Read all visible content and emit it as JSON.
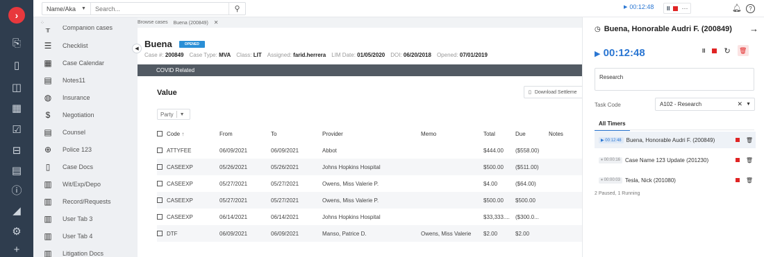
{
  "app": {
    "logo_glyph": "›",
    "accent": "#2a76d2",
    "danger": "#e02424",
    "rail_color": "#2f3d4e"
  },
  "rail": {
    "icons": [
      "briefcase-icon",
      "document-icon",
      "contact-card-icon",
      "calendar-icon",
      "checkbox-icon",
      "inbox-icon",
      "messages-icon",
      "info-icon",
      "chart-icon",
      "settings-icon",
      "plus-icon"
    ],
    "glyphs": [
      "⎘",
      "▯",
      "◫",
      "▦",
      "☑",
      "⊟",
      "▤",
      "ⓘ",
      "◢",
      "⚙",
      "+"
    ]
  },
  "topbar": {
    "search_scope": "Name/Aka",
    "search_placeholder": "Search...",
    "timer_display": "00:12:48",
    "more_glyph": "···"
  },
  "tabs": [
    "Browse cases",
    "Buena (200849)"
  ],
  "sidebar": {
    "partial_label": "Companion cases",
    "items": [
      {
        "label": "Checklist",
        "icon": "checklist-icon",
        "glyph": "☰"
      },
      {
        "label": "Case Calendar",
        "icon": "calendar-icon",
        "glyph": "▦"
      },
      {
        "label": "Notes11",
        "icon": "notes-icon",
        "glyph": "▤"
      },
      {
        "label": "Insurance",
        "icon": "shield-icon",
        "glyph": "◍"
      },
      {
        "label": "Negotiation",
        "icon": "dollar-icon",
        "glyph": "$"
      },
      {
        "label": "Counsel",
        "icon": "counsel-icon",
        "glyph": "▤"
      },
      {
        "label": "Police 123",
        "icon": "police-icon",
        "glyph": "⊕"
      },
      {
        "label": "Case Docs",
        "icon": "docs-icon",
        "glyph": "▯"
      },
      {
        "label": "Wit/Exp/Depo",
        "icon": "witness-icon",
        "glyph": "▥"
      },
      {
        "label": "Record/Requests",
        "icon": "records-icon",
        "glyph": "▥"
      },
      {
        "label": "User Tab 3",
        "icon": "user-tab-icon",
        "glyph": "▥"
      },
      {
        "label": "User Tab 4",
        "icon": "user-tab-icon",
        "glyph": "▥"
      },
      {
        "label": "Litigation Docs",
        "icon": "litigation-icon",
        "glyph": "▥"
      }
    ]
  },
  "case": {
    "title": "Buena",
    "status": "OPENED",
    "meta": [
      {
        "label": "Case #:",
        "value": "200849"
      },
      {
        "label": "Case Type:",
        "value": "MVA"
      },
      {
        "label": "Class:",
        "value": "LIT"
      },
      {
        "label": "Assigned:",
        "value": "farid.herrera"
      },
      {
        "label": "LIM Date:",
        "value": "01/05/2020"
      },
      {
        "label": "DOI:",
        "value": "06/20/2018"
      },
      {
        "label": "Opened:",
        "value": "07/01/2019"
      }
    ],
    "banner": "COVID Related"
  },
  "value_section": {
    "heading": "Value",
    "download_label": "Download Settleme",
    "party_filter": "Party",
    "columns": [
      "Code",
      "From",
      "To",
      "Provider",
      "Memo",
      "Total",
      "Due",
      "Notes"
    ],
    "rows": [
      {
        "code": "ATTYFEE",
        "from": "06/09/2021",
        "to": "06/09/2021",
        "provider": "Abbot",
        "memo": "",
        "total": "$444.00",
        "due": "($558.00)",
        "notes": ""
      },
      {
        "code": "CASEEXP",
        "from": "05/26/2021",
        "to": "05/26/2021",
        "provider": "Johns Hopkins Hospital",
        "memo": "",
        "total": "$500.00",
        "due": "($511.00)",
        "notes": ""
      },
      {
        "code": "CASEEXP",
        "from": "05/27/2021",
        "to": "05/27/2021",
        "provider": "Owens, Miss Valerie P.",
        "memo": "",
        "total": "$4.00",
        "due": "($64.00)",
        "notes": ""
      },
      {
        "code": "CASEEXP",
        "from": "05/27/2021",
        "to": "05/27/2021",
        "provider": "Owens, Miss Valerie P.",
        "memo": "",
        "total": "$500.00",
        "due": "$500.00",
        "notes": ""
      },
      {
        "code": "CASEEXP",
        "from": "06/14/2021",
        "to": "06/14/2021",
        "provider": "Johns Hopkins Hospital",
        "memo": "",
        "total": "$33,333....",
        "due": "($300.0...",
        "notes": ""
      },
      {
        "code": "DTF",
        "from": "06/09/2021",
        "to": "06/09/2021",
        "provider": "Manso, Patrice D.",
        "memo": "Owens, Miss Valerie",
        "total": "$2.00",
        "due": "$2.00",
        "notes": ""
      }
    ]
  },
  "timer_panel": {
    "title": "Buena, Honorable Audri F. (200849)",
    "timer": "00:12:48",
    "description": "Research",
    "task_code_label": "Task Code",
    "task_code_value": "A102 - Research",
    "tab_label": "All Timers",
    "timers": [
      {
        "time": "▶ 00:12:48",
        "name": "Buena, Honorable Audri F. (200849)",
        "state": "run"
      },
      {
        "time": "⏸ 00:00:16",
        "name": "Case Name 123 Update (201230)",
        "state": "pau"
      },
      {
        "time": "⏸ 00:00:03",
        "name": "Tesla, Nick (201080)",
        "state": "pau"
      }
    ],
    "summary": "2 Paused, 1 Running"
  }
}
